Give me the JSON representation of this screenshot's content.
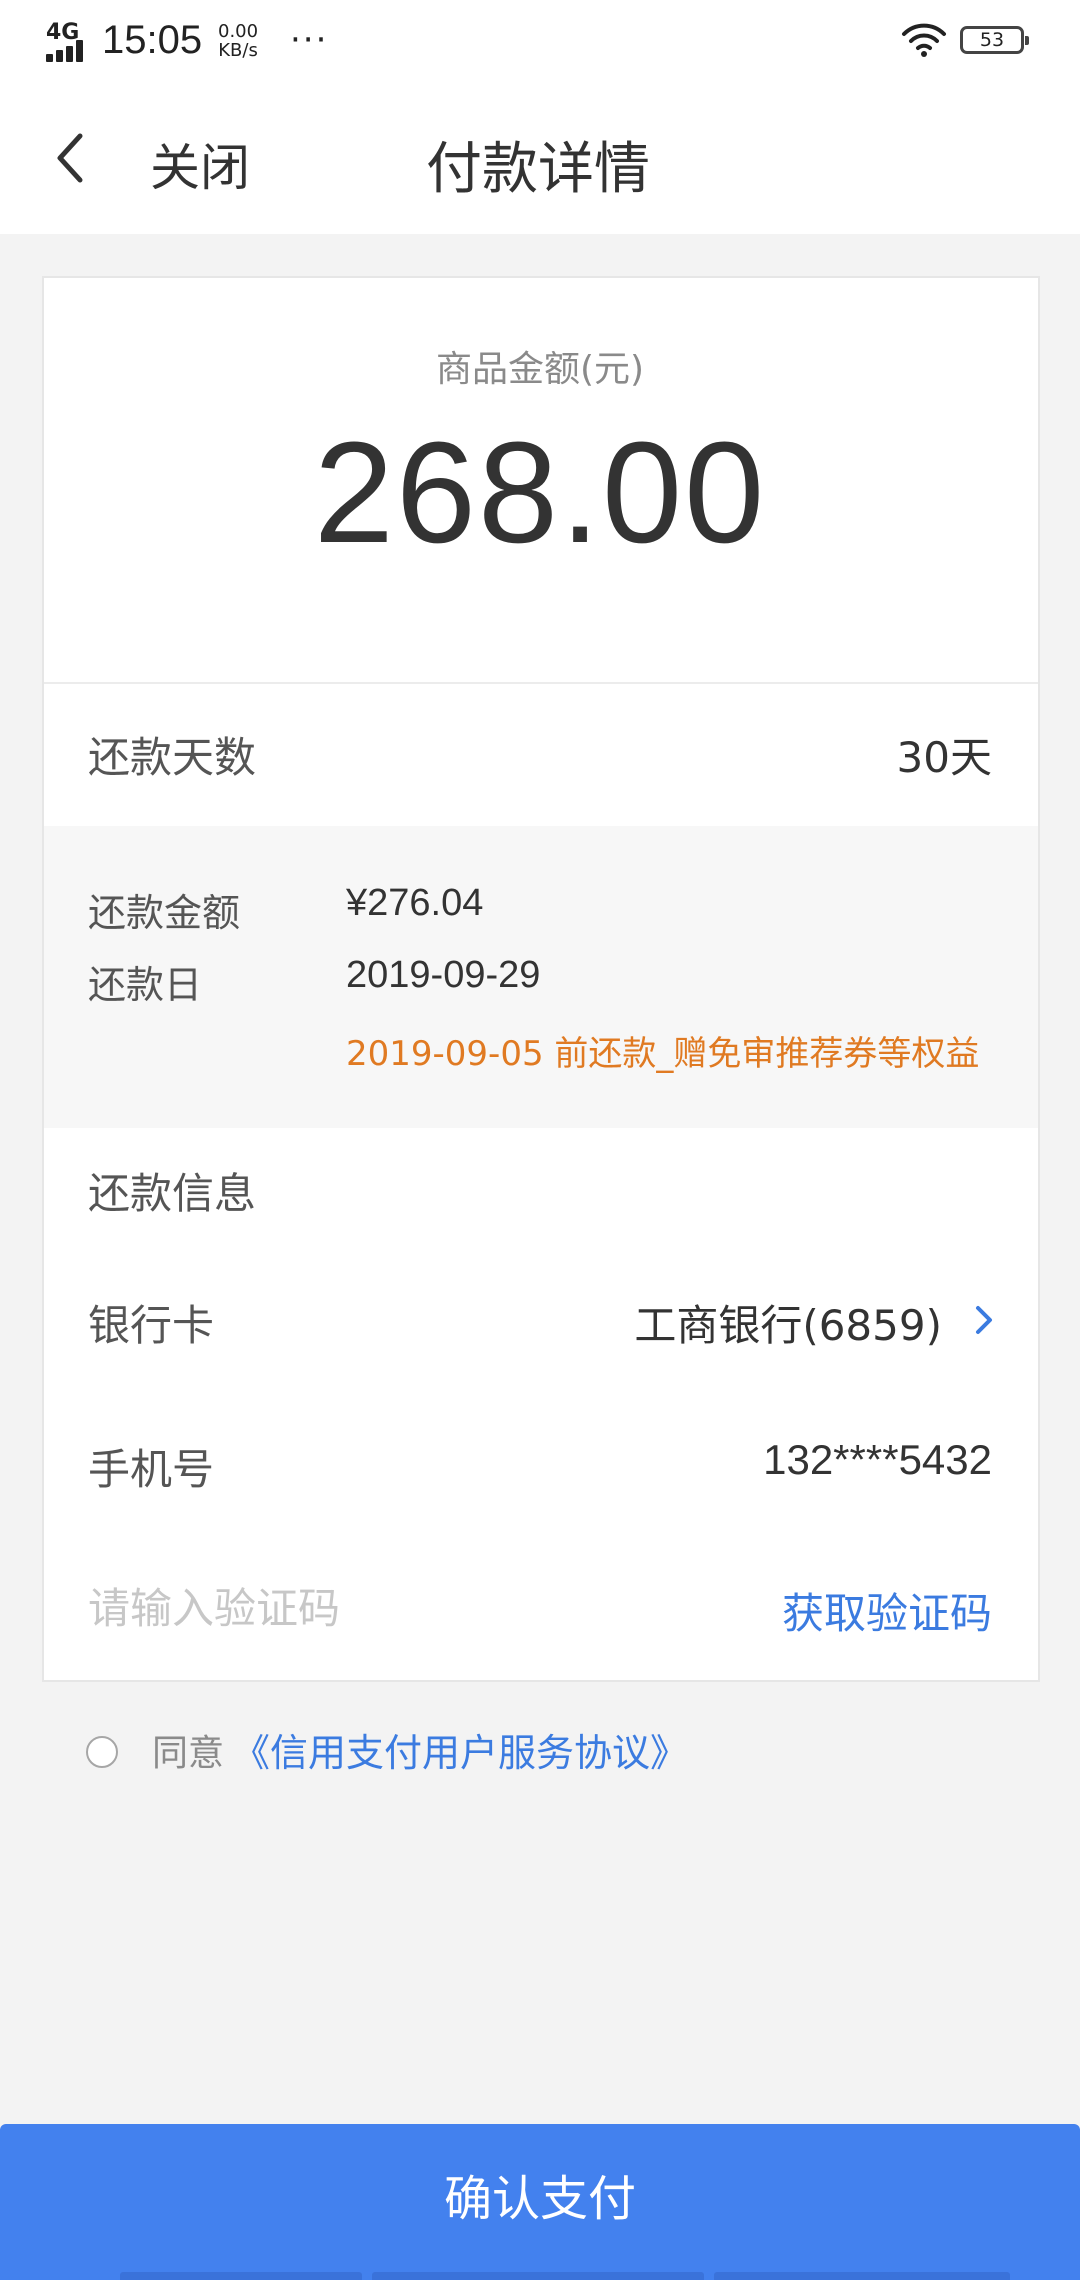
{
  "status_bar": {
    "network": "4G",
    "time": "15:05",
    "speed_value": "0.00",
    "speed_unit": "KB/s",
    "more": "···",
    "battery": "53"
  },
  "nav": {
    "close_label": "关闭",
    "title": "付款详情"
  },
  "amount": {
    "label": "商品金额(元)",
    "value": "268.00"
  },
  "repayment": {
    "days_label": "还款天数",
    "days_value": "30天",
    "amount_label": "还款金额",
    "amount_value": "¥276.04",
    "date_label": "还款日",
    "date_value": "2019-09-29",
    "promo_text": "2019-09-05 前还款_赠免审推荐券等权益"
  },
  "repay_info": {
    "title": "还款信息",
    "bank_label": "银行卡",
    "bank_value": "工商银行(6859)",
    "phone_label": "手机号",
    "phone_value": "132****5432",
    "code_placeholder": "请输入验证码",
    "get_code_label": "获取验证码"
  },
  "agreement": {
    "prefix": "同意",
    "link": "《信用支付用户服务协议》",
    "checked": false
  },
  "confirm_button": "确认支付",
  "colors": {
    "accent_blue": "#4381ee",
    "link_blue": "#3b7be0",
    "promo_orange": "#e07a22"
  }
}
